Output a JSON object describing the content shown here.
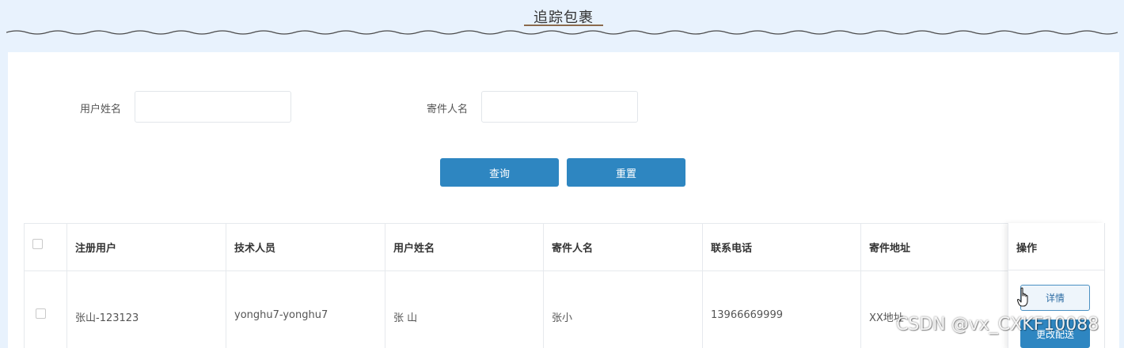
{
  "header": {
    "title": "追踪包裹"
  },
  "search": {
    "user_name_label": "用户姓名",
    "user_name_value": "",
    "sender_name_label": "寄件人名",
    "sender_name_value": "",
    "query_label": "查询",
    "reset_label": "重置"
  },
  "table": {
    "columns": [
      "注册用户",
      "技术人员",
      "用户姓名",
      "寄件人名",
      "联系电话",
      "寄件地址",
      "操作"
    ],
    "rows": [
      {
        "checked": false,
        "registered_user": "张山-123123",
        "technician": "yonghu7-yonghu7",
        "user_name": "张 山",
        "sender_name": "张小",
        "phone": "13966669999",
        "address": "XX地址",
        "actions": {
          "detail_label": "详情",
          "modify_label": "更改配送"
        }
      }
    ]
  },
  "watermark": "CSDN @vx_CXKF10088",
  "colors": {
    "page_background": "#e8f2fd",
    "primary_button": "#2e86c1",
    "title_underline": "#8b6a4c"
  },
  "icons": {
    "cursor": "hand-pointer-icon",
    "header_decoration": "wave-divider"
  }
}
